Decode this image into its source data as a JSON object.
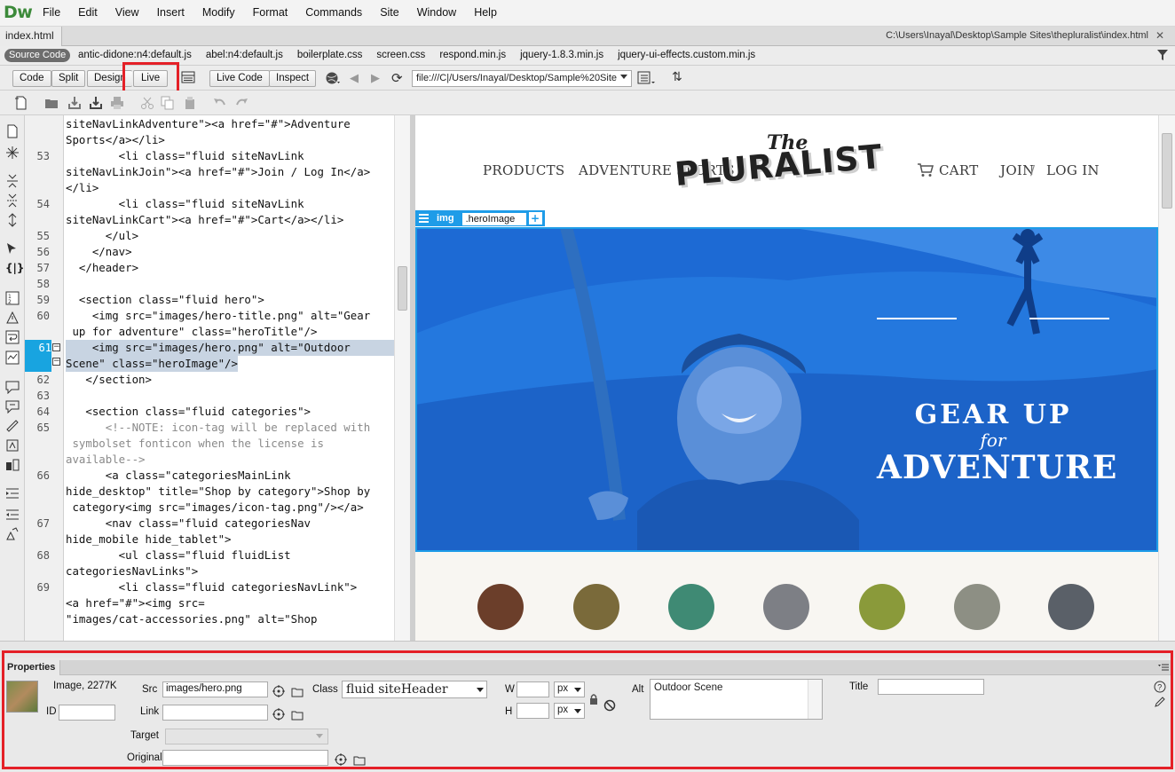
{
  "app": {
    "logo": "Dw",
    "menu": [
      "File",
      "Edit",
      "View",
      "Insert",
      "Modify",
      "Format",
      "Commands",
      "Site",
      "Window",
      "Help"
    ]
  },
  "document": {
    "tab_name": "index.html",
    "path": "C:\\Users\\Inayal\\Desktop\\Sample Sites\\thepluralist\\index.html"
  },
  "related_files": {
    "source_code_label": "Source Code",
    "files": [
      "antic-didone:n4:default.js",
      "abel:n4:default.js",
      "boilerplate.css",
      "screen.css",
      "respond.min.js",
      "jquery-1.8.3.min.js",
      "jquery-ui-effects.custom.min.js"
    ]
  },
  "toolbar": {
    "code_label": "Code",
    "split_label": "Split",
    "design_label": "Design",
    "live_label": "Live",
    "live_code_label": "Live Code",
    "inspect_label": "Inspect",
    "address": "file:///C|/Users/Inayal/Desktop/Sample%20Site"
  },
  "code": {
    "lines": [
      {
        "num": "",
        "text": "siteNavLinkAdventure\"><a href=\"#\">Adventure"
      },
      {
        "num": "",
        "text": "Sports</a></li>"
      },
      {
        "num": "53",
        "text": "        <li class=\"fluid siteNavLink"
      },
      {
        "num": "",
        "text": "siteNavLinkJoin\"><a href=\"#\">Join / Log In</a>"
      },
      {
        "num": "",
        "text": "</li>"
      },
      {
        "num": "54",
        "text": "        <li class=\"fluid siteNavLink"
      },
      {
        "num": "",
        "text": "siteNavLinkCart\"><a href=\"#\">Cart</a></li>"
      },
      {
        "num": "55",
        "text": "      </ul>"
      },
      {
        "num": "56",
        "text": "    </nav>"
      },
      {
        "num": "57",
        "text": "  </header>"
      },
      {
        "num": "58",
        "text": ""
      },
      {
        "num": "59",
        "text": "  <section class=\"fluid hero\">"
      },
      {
        "num": "60",
        "text": "    <img src=\"images/hero-title.png\" alt=\"Gear"
      },
      {
        "num": "",
        "text": " up for adventure\" class=\"heroTitle\"/>"
      },
      {
        "num": "61",
        "text": "    <img src=\"images/hero.png\" alt=\"Outdoor"
      },
      {
        "num": "",
        "text": "Scene\" class=\"heroImage\"/>"
      },
      {
        "num": "62",
        "text": "   </section>"
      },
      {
        "num": "63",
        "text": ""
      },
      {
        "num": "64",
        "text": "   <section class=\"fluid categories\">"
      },
      {
        "num": "65",
        "text": "      <!--NOTE: icon-tag will be replaced with"
      },
      {
        "num": "",
        "text": " symbolset fonticon when the license is"
      },
      {
        "num": "",
        "text": "available-->"
      },
      {
        "num": "66",
        "text": "      <a class=\"categoriesMainLink"
      },
      {
        "num": "",
        "text": "hide_desktop\" title=\"Shop by category\">Shop by"
      },
      {
        "num": "",
        "text": " category<img src=\"images/icon-tag.png\"/></a>"
      },
      {
        "num": "67",
        "text": "      <nav class=\"fluid categoriesNav"
      },
      {
        "num": "",
        "text": "hide_mobile hide_tablet\">"
      },
      {
        "num": "68",
        "text": "        <ul class=\"fluid fluidList"
      },
      {
        "num": "",
        "text": "categoriesNavLinks\">"
      },
      {
        "num": "69",
        "text": "        <li class=\"fluid categoriesNavLink\">"
      },
      {
        "num": "",
        "text": "<a href=\"#\"><img src="
      },
      {
        "num": "",
        "text": "\"images/cat-accessories.png\" alt=\"Shop"
      }
    ]
  },
  "live": {
    "nav": {
      "products": "PRODUCTS",
      "adventure": "ADVENTURE SPORTS",
      "cart": "CART",
      "join": "JOIN",
      "slash": "/",
      "login": "LOG IN"
    },
    "logo_the": "The",
    "logo_main": "PLURALIST",
    "hud_tag": "img",
    "hud_class": ".heroImage",
    "hud_add": "+",
    "hero_line1": "GEAR UP",
    "hero_line2": "for",
    "hero_line3": "ADVENTURE",
    "category_colors": [
      "#6b3e2a",
      "#7a6a3a",
      "#3f8a74",
      "#7d7f85",
      "#8a9a3a",
      "#8d8f84",
      "#5a6068"
    ]
  },
  "properties": {
    "tab_label": "Properties",
    "image_info": "Image, 2277K",
    "id_label": "ID",
    "id_value": "",
    "src_label": "Src",
    "src_value": "images/hero.png",
    "link_label": "Link",
    "link_value": "",
    "class_label": "Class",
    "class_value": "fluid siteHeader",
    "w_label": "W",
    "w_value": "",
    "h_label": "H",
    "h_value": "",
    "unit_w": "px",
    "unit_h": "px",
    "alt_label": "Alt",
    "alt_value": "Outdoor Scene",
    "title_label": "Title",
    "title_value": "",
    "target_label": "Target",
    "target_value": "",
    "original_label": "Original",
    "original_value": ""
  }
}
